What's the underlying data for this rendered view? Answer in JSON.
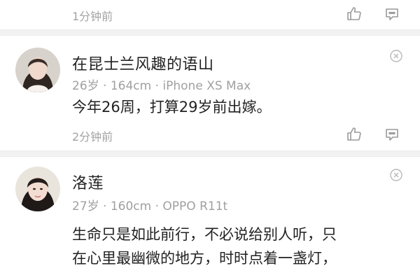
{
  "prev": {
    "time": "1分钟前"
  },
  "comments": [
    {
      "name": "在昆士兰风趣的语山",
      "meta": "26岁 · 164cm · iPhone XS Max",
      "text": "今年26周，打算29岁前出嫁。",
      "time": "2分钟前"
    },
    {
      "name": "洛莲",
      "meta": "27岁 · 160cm · OPPO R11t",
      "text": "生命只是如此前行，不必说给别人听，只在心里最幽微的地方，时时点着一盏灯，",
      "text_line1": "生命只是如此前行，不必说给别人听，只",
      "text_line2": "在心里最幽微的地方，时时点着一盏灯，"
    }
  ],
  "icons": {
    "like": "thumbs-up-icon",
    "reply": "comment-icon",
    "close": "close-icon"
  },
  "colors": {
    "meta": "#a0a0a0",
    "text": "#222222",
    "separator": "#f2f2f2"
  }
}
